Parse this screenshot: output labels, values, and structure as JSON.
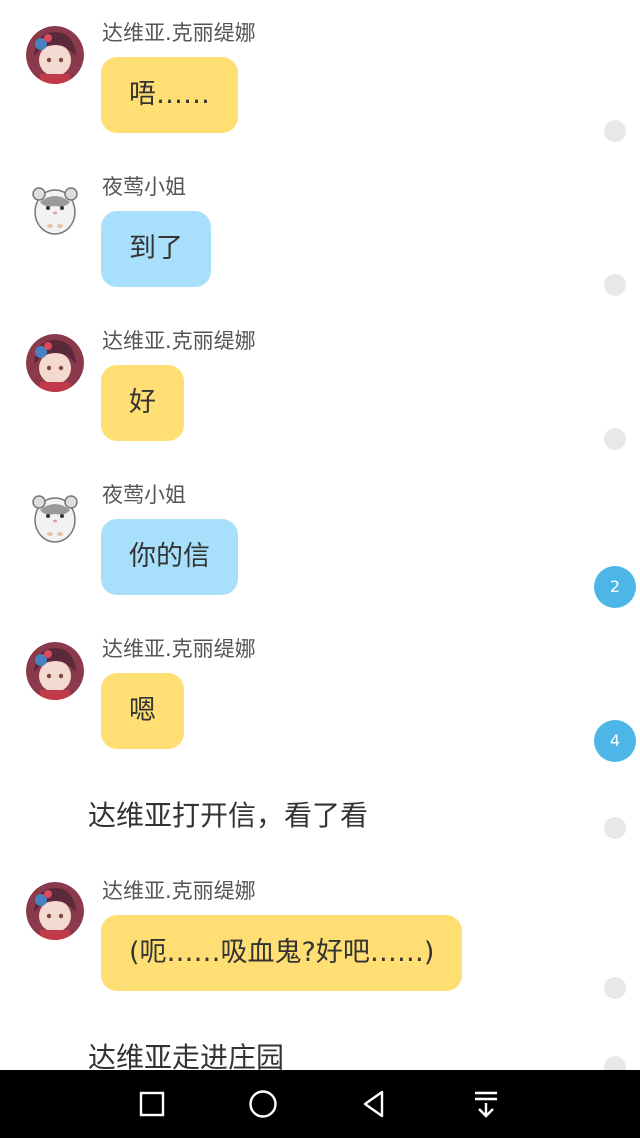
{
  "messages": [
    {
      "type": "chat",
      "sender": "达维亚.克丽缇娜",
      "text": "唔……",
      "style": "yellow",
      "avatar": "girl-avatar",
      "indicator": "dot"
    },
    {
      "type": "chat",
      "sender": "夜莺小姐",
      "text": "到了",
      "style": "blue",
      "avatar": "hamster-avatar",
      "indicator": "dot"
    },
    {
      "type": "chat",
      "sender": "达维亚.克丽缇娜",
      "text": "好",
      "style": "yellow",
      "avatar": "girl-avatar",
      "indicator": "dot"
    },
    {
      "type": "chat",
      "sender": "夜莺小姐",
      "text": "你的信",
      "style": "blue",
      "avatar": "hamster-avatar",
      "indicator": "2"
    },
    {
      "type": "chat",
      "sender": "达维亚.克丽缇娜",
      "text": "嗯",
      "style": "yellow",
      "avatar": "girl-avatar",
      "indicator": "4"
    },
    {
      "type": "narration",
      "text": "达维亚打开信，看了看",
      "indicator": "dot"
    },
    {
      "type": "chat",
      "sender": "达维亚.克丽缇娜",
      "text": "(呃……吸血鬼?好吧……)",
      "style": "yellow",
      "avatar": "girl-avatar",
      "indicator": "dot"
    },
    {
      "type": "narration",
      "text": "达维亚走进庄园",
      "indicator": "dot"
    }
  ],
  "colors": {
    "yellow_bubble": "#ffdf73",
    "blue_bubble": "#a8e0fb",
    "count_badge": "#4db6e6",
    "navbar": "#000000"
  },
  "navbar": {
    "buttons": [
      "recent-apps-icon",
      "home-icon",
      "back-icon",
      "notification-pull-icon"
    ]
  }
}
